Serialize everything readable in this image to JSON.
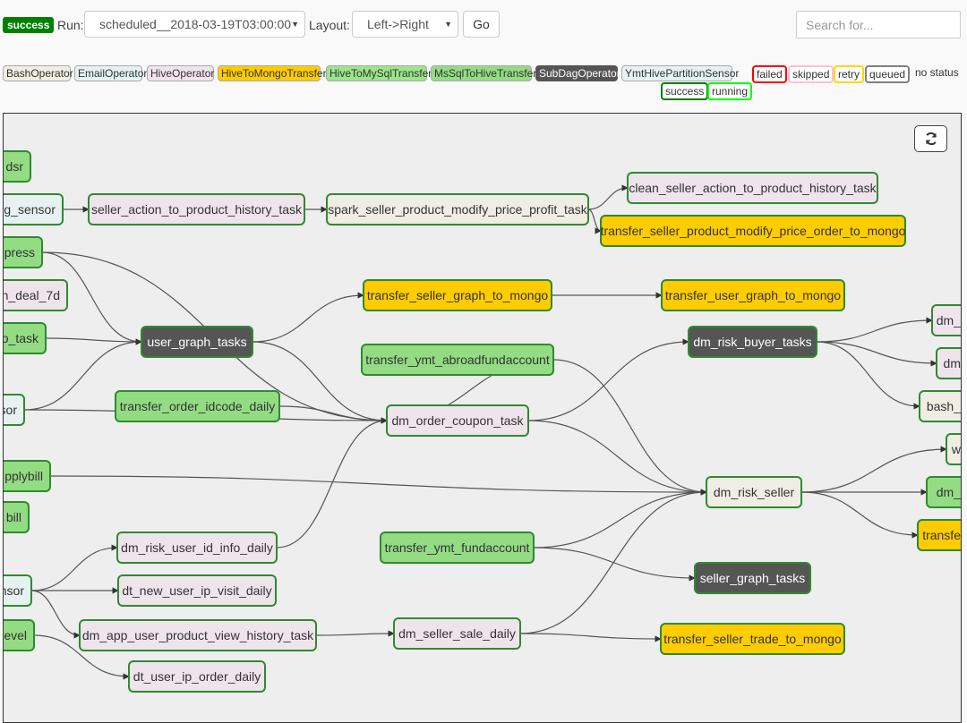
{
  "toolbar": {
    "state": "success",
    "run_label": "Run:",
    "run_value": "scheduled__2018-03-19T03:00:00",
    "layout_label": "Layout:",
    "layout_value": "Left->Right",
    "go_label": "Go",
    "search_placeholder": "Search for..."
  },
  "operators_legend": [
    {
      "label": "BashOperator",
      "color": "#f0ede4"
    },
    {
      "label": "EmailOperator",
      "color": "#e6f1f2"
    },
    {
      "label": "HiveOperator",
      "color": "#f0e4ec"
    },
    {
      "label": "HiveToMongoTransfer",
      "color": "#ffcc00"
    },
    {
      "label": "HiveToMySqlTransfer",
      "color": "#9ae58b"
    },
    {
      "label": "MsSqlToHiveTransfer",
      "color": "#93dc84"
    },
    {
      "label": "SubDagOperator",
      "color": "#555555",
      "text_color": "#ffffff"
    },
    {
      "label": "YmtHivePartitionSensor",
      "color": "#e8f1f1"
    }
  ],
  "status_legend": [
    {
      "label": "failed",
      "color": "#ff0000"
    },
    {
      "label": "skipped",
      "color": "#ffc0cb"
    },
    {
      "label": "retry",
      "color": "#ffd700"
    },
    {
      "label": "queued",
      "color": "#808080"
    },
    {
      "label": "no status",
      "color": null
    },
    {
      "label": "success",
      "color": "#008000"
    },
    {
      "label": "running",
      "color": "#00ff00"
    }
  ],
  "graph": {
    "refresh_icon": "refresh-icon",
    "nodes": [
      {
        "id": "n1",
        "label": "dsr",
        "type": "MsSqlToHiveTransfer"
      },
      {
        "id": "n2",
        "label": "g_sensor",
        "type": "YmtHivePartitionSensor"
      },
      {
        "id": "n3",
        "label": "seller_action_to_product_history_task",
        "type": "HiveOperator"
      },
      {
        "id": "n4",
        "label": "spark_seller_product_modify_price_profit_task",
        "type": "BashOperator"
      },
      {
        "id": "n5",
        "label": "clean_seller_action_to_product_history_task",
        "type": "HiveOperator"
      },
      {
        "id": "n6",
        "label": "transfer_seller_product_modify_price_order_to_mongo",
        "type": "HiveToMongoTransfer"
      },
      {
        "id": "n7",
        "label": "press",
        "type": "MsSqlToHiveTransfer"
      },
      {
        "id": "n8",
        "label": "n_deal_7d",
        "type": "HiveOperator"
      },
      {
        "id": "n9",
        "label": "transfer_seller_graph_to_mongo",
        "type": "HiveToMongoTransfer"
      },
      {
        "id": "n10",
        "label": "transfer_user_graph_to_mongo",
        "type": "HiveToMongoTransfer"
      },
      {
        "id": "n11",
        "label": "o_task",
        "type": "MsSqlToHiveTransfer"
      },
      {
        "id": "n12",
        "label": "user_graph_tasks",
        "type": "SubDagOperator"
      },
      {
        "id": "n13",
        "label": "dm_risk_buyer_tasks",
        "type": "SubDagOperator"
      },
      {
        "id": "n14",
        "label": "transfer_ymt_abroadfundaccount",
        "type": "MsSqlToHiveTransfer"
      },
      {
        "id": "n15",
        "label": "dm_",
        "type": "HiveOperator"
      },
      {
        "id": "n16",
        "label": "dm",
        "type": "HiveOperator"
      },
      {
        "id": "n17",
        "label": "sor",
        "type": "YmtHivePartitionSensor"
      },
      {
        "id": "n18",
        "label": "transfer_order_idcode_daily",
        "type": "MsSqlToHiveTransfer"
      },
      {
        "id": "n19",
        "label": "dm_order_coupon_task",
        "type": "HiveOperator"
      },
      {
        "id": "n20",
        "label": "bash_",
        "type": "BashOperator"
      },
      {
        "id": "n21",
        "label": "w",
        "type": "BashOperator"
      },
      {
        "id": "n22",
        "label": "pplybill",
        "type": "MsSqlToHiveTransfer"
      },
      {
        "id": "n23",
        "label": "dm_risk_seller",
        "type": "BashOperator"
      },
      {
        "id": "n24",
        "label": "dm_",
        "type": "MsSqlToHiveTransfer"
      },
      {
        "id": "n25",
        "label": "bill",
        "type": "MsSqlToHiveTransfer"
      },
      {
        "id": "n26",
        "label": "transfe",
        "type": "HiveToMongoTransfer"
      },
      {
        "id": "n27",
        "label": "dm_risk_user_id_info_daily",
        "type": "HiveOperator"
      },
      {
        "id": "n28",
        "label": "transfer_ymt_fundaccount",
        "type": "MsSqlToHiveTransfer"
      },
      {
        "id": "n29",
        "label": "seller_graph_tasks",
        "type": "SubDagOperator"
      },
      {
        "id": "n30",
        "label": "nsor",
        "type": "YmtHivePartitionSensor"
      },
      {
        "id": "n31",
        "label": "dt_new_user_ip_visit_daily",
        "type": "HiveOperator"
      },
      {
        "id": "n32",
        "label": "evel",
        "type": "MsSqlToHiveTransfer"
      },
      {
        "id": "n33",
        "label": "dm_app_user_product_view_history_task",
        "type": "HiveOperator"
      },
      {
        "id": "n34",
        "label": "dm_seller_sale_daily",
        "type": "HiveOperator"
      },
      {
        "id": "n35",
        "label": "transfer_seller_trade_to_mongo",
        "type": "HiveToMongoTransfer"
      },
      {
        "id": "n36",
        "label": "dt_user_ip_order_daily",
        "type": "HiveOperator"
      }
    ],
    "edges": [
      [
        "n2",
        "n3"
      ],
      [
        "n3",
        "n4"
      ],
      [
        "n4",
        "n5"
      ],
      [
        "n4",
        "n6"
      ],
      [
        "n7",
        "n12"
      ],
      [
        "n7",
        "n19"
      ],
      [
        "n11",
        "n12"
      ],
      [
        "n17",
        "n12"
      ],
      [
        "n12",
        "n9"
      ],
      [
        "n12",
        "n19"
      ],
      [
        "n9",
        "n10"
      ],
      [
        "n14",
        "n19"
      ],
      [
        "n14",
        "n23"
      ],
      [
        "n18",
        "n19"
      ],
      [
        "n17",
        "n19"
      ],
      [
        "n19",
        "n13"
      ],
      [
        "n19",
        "n23"
      ],
      [
        "n13",
        "n15"
      ],
      [
        "n13",
        "n16"
      ],
      [
        "n13",
        "n20"
      ],
      [
        "n22",
        "n23"
      ],
      [
        "n27",
        "n19"
      ],
      [
        "n28",
        "n23"
      ],
      [
        "n28",
        "n29"
      ],
      [
        "n34",
        "n23"
      ],
      [
        "n34",
        "n35"
      ],
      [
        "n23",
        "n21"
      ],
      [
        "n23",
        "n24"
      ],
      [
        "n23",
        "n26"
      ],
      [
        "n30",
        "n27"
      ],
      [
        "n30",
        "n31"
      ],
      [
        "n30",
        "n33"
      ],
      [
        "n32",
        "n36"
      ],
      [
        "n33",
        "n34"
      ]
    ]
  }
}
